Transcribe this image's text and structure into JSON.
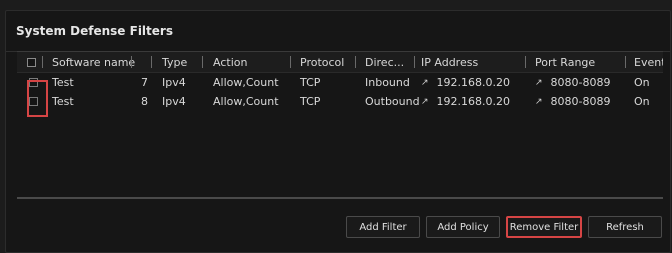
{
  "panel": {
    "title": "System Defense Filters"
  },
  "table": {
    "headers": {
      "software_name": "Software name",
      "type": "Type",
      "action": "Action",
      "protocol": "Protocol",
      "direction": "Direc...",
      "ip": "IP Address",
      "port": "Port Range",
      "event": "Event"
    },
    "rows": [
      {
        "software": "Test",
        "id": "7",
        "type": "Ipv4",
        "action": "Allow,Count",
        "protocol": "TCP",
        "direction": "Inbound",
        "ip": "192.168.0.20",
        "port": "8080-8089",
        "event": "On"
      },
      {
        "software": "Test",
        "id": "8",
        "type": "Ipv4",
        "action": "Allow,Count",
        "protocol": "TCP",
        "direction": "Outbound",
        "ip": "192.168.0.20",
        "port": "8080-8089",
        "event": "On"
      }
    ]
  },
  "buttons": {
    "add_filter": "Add Filter",
    "add_policy": "Add Policy",
    "remove_filter": "Remove Filter",
    "refresh": "Refresh"
  },
  "colors": {
    "highlight": "#d64545",
    "background": "#161616"
  },
  "icons": {
    "ip": "link-edit-icon",
    "port": "link-edit-icon"
  }
}
